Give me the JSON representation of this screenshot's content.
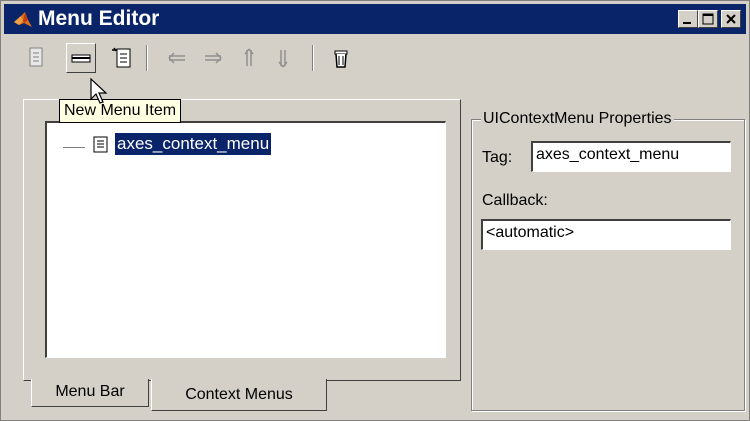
{
  "window": {
    "title": "Menu Editor"
  },
  "toolbar": {
    "tooltip": "New Menu Item",
    "icons": [
      "menu-item-icon",
      "new-menu-item-icon",
      "new-context-menu-icon",
      "move-left-icon",
      "move-right-icon",
      "move-up-icon",
      "move-down-icon",
      "delete-icon"
    ]
  },
  "tree": {
    "items": [
      {
        "label": "axes_context_menu",
        "selected": true
      }
    ]
  },
  "tabs": [
    {
      "label": "Menu Bar",
      "active": false
    },
    {
      "label": "Context Menus",
      "active": true
    }
  ],
  "properties": {
    "group_title": "UIContextMenu Properties",
    "tag_label": "Tag:",
    "tag_value": "axes_context_menu",
    "callback_label": "Callback:",
    "callback_value": "<automatic>"
  },
  "colors": {
    "titlebar": "#0a246a",
    "face": "#d4d0c8",
    "selection": "#0a246a",
    "tooltip_bg": "#ffffe1"
  }
}
